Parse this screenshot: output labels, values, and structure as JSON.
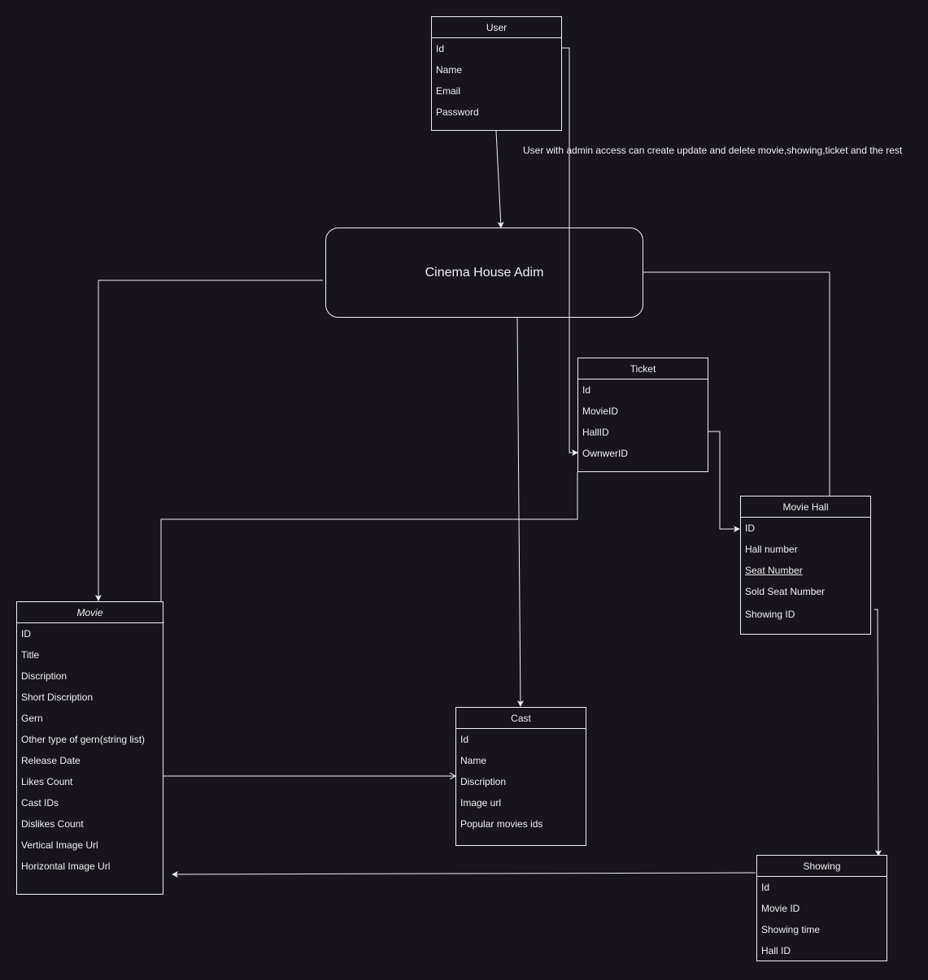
{
  "diagram": {
    "type": "entity-relationship",
    "colors": {
      "background": "#18141d",
      "stroke": "#f0f0f0",
      "text": "#f0f0f0"
    },
    "note": "User with admin access can create update and delete movie,showing,ticket and the rest",
    "process": {
      "label": "Cinema House Adim"
    },
    "entities": {
      "user": {
        "title": "User",
        "fields": [
          "Id",
          "Name",
          "Email",
          "Password"
        ]
      },
      "ticket": {
        "title": "Ticket",
        "fields": [
          "Id",
          "MovieID",
          "HallID",
          "OwnwerID"
        ]
      },
      "movie_hall": {
        "title": "Movie Hall",
        "fields": [
          "ID",
          "Hall number",
          "Seat Number",
          "Sold Seat Number",
          "Showing ID"
        ],
        "underlined_field": "Seat Number"
      },
      "movie": {
        "title": "Movie",
        "fields": [
          "ID",
          "Title",
          "Discription",
          "Short Discription",
          "Gern",
          "Other type of gern(string list)",
          "Release Date",
          "Likes Count",
          "Cast IDs",
          "Dislikes Count",
          "Vertical Image Url",
          "Horizontal Image Url"
        ]
      },
      "cast": {
        "title": "Cast",
        "fields": [
          "Id",
          "Name",
          "Discription",
          "Image url",
          "Popular movies ids"
        ]
      },
      "showing": {
        "title": "Showing",
        "fields": [
          "Id",
          "Movie ID",
          "Showing time",
          "Hall ID"
        ]
      }
    },
    "edges": [
      {
        "from": "User",
        "to": "Cinema House Adim"
      },
      {
        "from": "User.Id",
        "to": "Ticket.OwnwerID"
      },
      {
        "from": "Cinema House Adim",
        "to": "Movie"
      },
      {
        "from": "Cinema House Adim",
        "to": "Movie Hall"
      },
      {
        "from": "Cinema House Adim",
        "to": "Cast"
      },
      {
        "from": "Ticket",
        "to": "Movie"
      },
      {
        "from": "Ticket.HallID",
        "to": "Movie Hall.ID"
      },
      {
        "from": "Movie Hall.Showing ID",
        "to": "Showing"
      },
      {
        "from": "Showing",
        "to": "Movie"
      },
      {
        "from": "Movie",
        "to": "Cast"
      }
    ]
  }
}
